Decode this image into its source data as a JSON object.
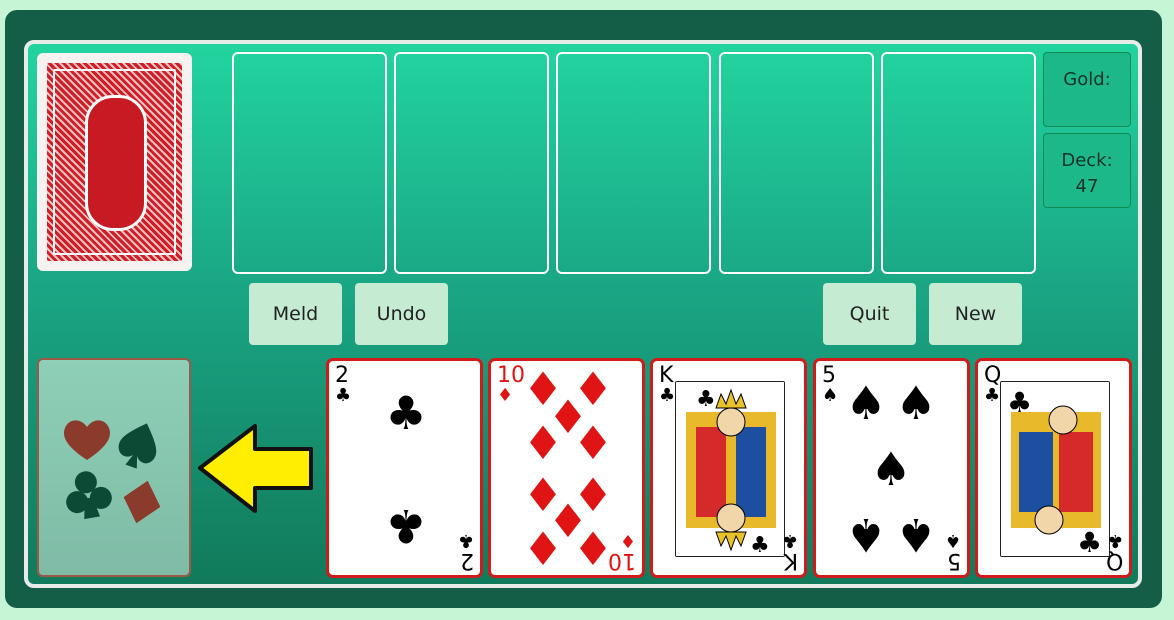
{
  "info": {
    "gold_label": "Gold:",
    "gold_value": "",
    "deck_label": "Deck:",
    "deck_value": "47"
  },
  "buttons": {
    "meld": "Meld",
    "undo": "Undo",
    "quit": "Quit",
    "new": "New"
  },
  "hand": [
    {
      "rank": "2",
      "suit": "♣",
      "color": "black"
    },
    {
      "rank": "10",
      "suit": "♦",
      "color": "red"
    },
    {
      "rank": "K",
      "suit": "♣",
      "color": "black"
    },
    {
      "rank": "5",
      "suit": "♠",
      "color": "black"
    },
    {
      "rank": "Q",
      "suit": "♣",
      "color": "black"
    }
  ],
  "meld_slots": 5,
  "colors": {
    "board_top": "#22d49f",
    "board_bottom": "#117a5b",
    "card_border": "#d11a1a",
    "button_bg": "#c5ebd2",
    "arrow_fill": "#ffee00"
  }
}
